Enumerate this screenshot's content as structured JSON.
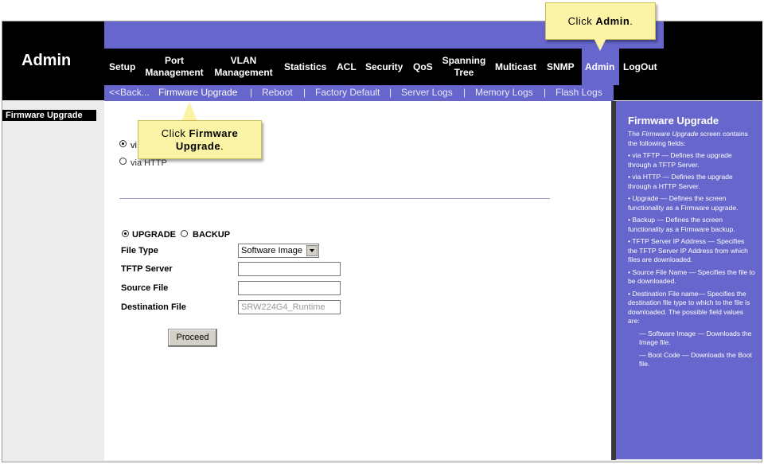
{
  "header": {
    "title": "Admin",
    "nav": [
      {
        "label": "Setup"
      },
      {
        "label": "Port\nManagement"
      },
      {
        "label": "VLAN\nManagement"
      },
      {
        "label": "Statistics"
      },
      {
        "label": "ACL"
      },
      {
        "label": "Security"
      },
      {
        "label": "QoS"
      },
      {
        "label": "Spanning\nTree"
      },
      {
        "label": "Multicast"
      },
      {
        "label": "SNMP"
      },
      {
        "label": "Admin",
        "active": true
      },
      {
        "label": "LogOut"
      }
    ]
  },
  "subnav": {
    "items": [
      {
        "label": "<<Back..."
      },
      {
        "label": "Firmware Upgrade",
        "active": true
      },
      {
        "label": "Reboot"
      },
      {
        "label": "Factory Default"
      },
      {
        "label": "Server Logs"
      },
      {
        "label": "Memory Logs"
      },
      {
        "label": "Flash Logs"
      }
    ],
    "separator": "|"
  },
  "sidebar": {
    "label": "Firmware Upgrade"
  },
  "callouts": {
    "admin": {
      "prefix": "Click ",
      "bold": "Admin",
      "suffix": "."
    },
    "firmware": {
      "prefix": "Click ",
      "bold": "Firmware\nUpgrade",
      "suffix": "."
    }
  },
  "form": {
    "via_tftp": {
      "label": "via TFTP",
      "visible_text": "vi",
      "checked": true
    },
    "via_http": {
      "label": "via HTTP",
      "checked": false
    },
    "mode_upgrade": {
      "label": "UPGRADE",
      "checked": true
    },
    "mode_backup": {
      "label": "BACKUP",
      "checked": false
    },
    "file_type": {
      "label": "File Type",
      "value": "Software Image"
    },
    "tftp_server": {
      "label": "TFTP Server",
      "value": ""
    },
    "source_file": {
      "label": "Source File",
      "value": ""
    },
    "destination_file": {
      "label": "Destination File",
      "value": "SRW224G4_Runtime"
    },
    "proceed_label": "Proceed"
  },
  "help": {
    "title": "Firmware Upgrade",
    "intro_pre": "The ",
    "intro_em": "Firmware Upgrade",
    "intro_post": " screen contains the following fields:",
    "items": [
      "• via TFTP — Defines the upgrade through a TFTP Server.",
      "• via HTTP — Defines the upgrade through a HTTP Server.",
      "• Upgrade — Defines the screen functionality as a Firmware upgrade.",
      "• Backup — Defines the screen functionality as a Firmware backup.",
      "• TFTP Server IP Address — Specifies the TFTP Server IP Address from which files are downloaded.",
      "• Source File Name — Specifies the file to be downloaded.",
      "• Destination File name— Specifies the destination file type to which to the file is downloaded. The possible field values are:"
    ],
    "sub_items": [
      "— Software Image — Downloads the Image file.",
      "— Boot Code — Downloads the Boot file."
    ]
  },
  "colors": {
    "purple": "#6666cc",
    "callout": "#fbf4a6"
  }
}
